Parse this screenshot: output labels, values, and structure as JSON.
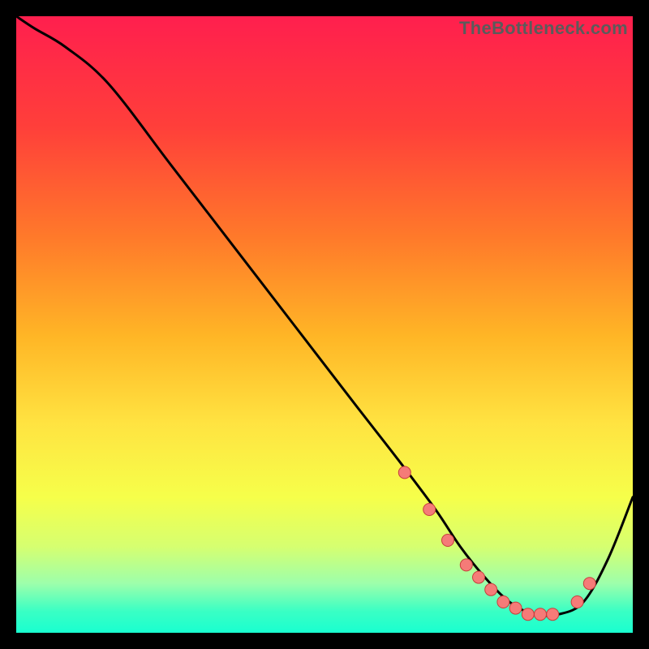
{
  "watermark": "TheBottleneck.com",
  "colors": {
    "bg": "#000000",
    "curve": "#000000",
    "marker_fill": "#f57b78",
    "marker_stroke": "#c63f3c",
    "gradient_stops": [
      {
        "offset": 0.0,
        "color": "#ff1f4e"
      },
      {
        "offset": 0.18,
        "color": "#ff3f3a"
      },
      {
        "offset": 0.36,
        "color": "#ff7a2a"
      },
      {
        "offset": 0.52,
        "color": "#ffb626"
      },
      {
        "offset": 0.66,
        "color": "#ffe341"
      },
      {
        "offset": 0.78,
        "color": "#f6ff4a"
      },
      {
        "offset": 0.86,
        "color": "#d6ff70"
      },
      {
        "offset": 0.92,
        "color": "#9dffab"
      },
      {
        "offset": 0.965,
        "color": "#3affc4"
      },
      {
        "offset": 1.0,
        "color": "#19ffd0"
      }
    ]
  },
  "chart_data": {
    "type": "line",
    "title": "",
    "xlabel": "",
    "ylabel": "",
    "xlim": [
      0,
      100
    ],
    "ylim": [
      0,
      100
    ],
    "series": [
      {
        "name": "bottleneck-curve",
        "x": [
          0,
          3,
          8,
          15,
          25,
          35,
          45,
          55,
          62,
          68,
          72,
          76,
          80,
          84,
          88,
          92,
          96,
          100
        ],
        "y": [
          100,
          98,
          95,
          89,
          76,
          63,
          50,
          37,
          28,
          20,
          14,
          9,
          5,
          3,
          3,
          5,
          12,
          22
        ]
      }
    ],
    "markers": {
      "name": "highlighted-points",
      "x": [
        63,
        67,
        70,
        73,
        75,
        77,
        79,
        81,
        83,
        85,
        87,
        91,
        93
      ],
      "y": [
        26,
        20,
        15,
        11,
        9,
        7,
        5,
        4,
        3,
        3,
        3,
        5,
        8
      ]
    }
  }
}
